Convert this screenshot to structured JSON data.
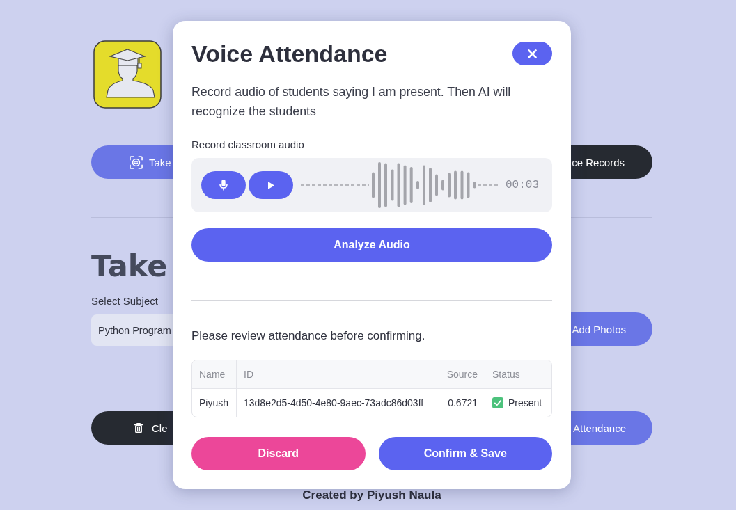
{
  "page": {
    "top_actions": [
      "Take",
      "ce Records"
    ],
    "heading": "Take",
    "subject": {
      "label": "Select Subject",
      "value": "Python Program",
      "button": "Add Photos"
    },
    "bottom_actions": [
      "Cle",
      "Attendance"
    ],
    "footer": "Created by Piyush Naula"
  },
  "dialog": {
    "title": "Voice Attendance",
    "description": "Record audio of students saying I am present. Then AI will recognize the students",
    "recorder": {
      "label": "Record classroom audio",
      "time": "00:03"
    },
    "analyze_button": "Analyze Audio",
    "review_note": "Please review attendance before confirming.",
    "table": {
      "columns": [
        "Name",
        "ID",
        "Source",
        "Status"
      ],
      "rows": [
        {
          "name": "Piyush",
          "id": "13d8e2d5-4d50-4e80-9aec-73adc86d03ff",
          "source": "0.6721",
          "status": {
            "kind": "present",
            "label": "Present"
          }
        }
      ]
    },
    "buttons": [
      "Discard",
      "Confirm & Save"
    ]
  }
}
